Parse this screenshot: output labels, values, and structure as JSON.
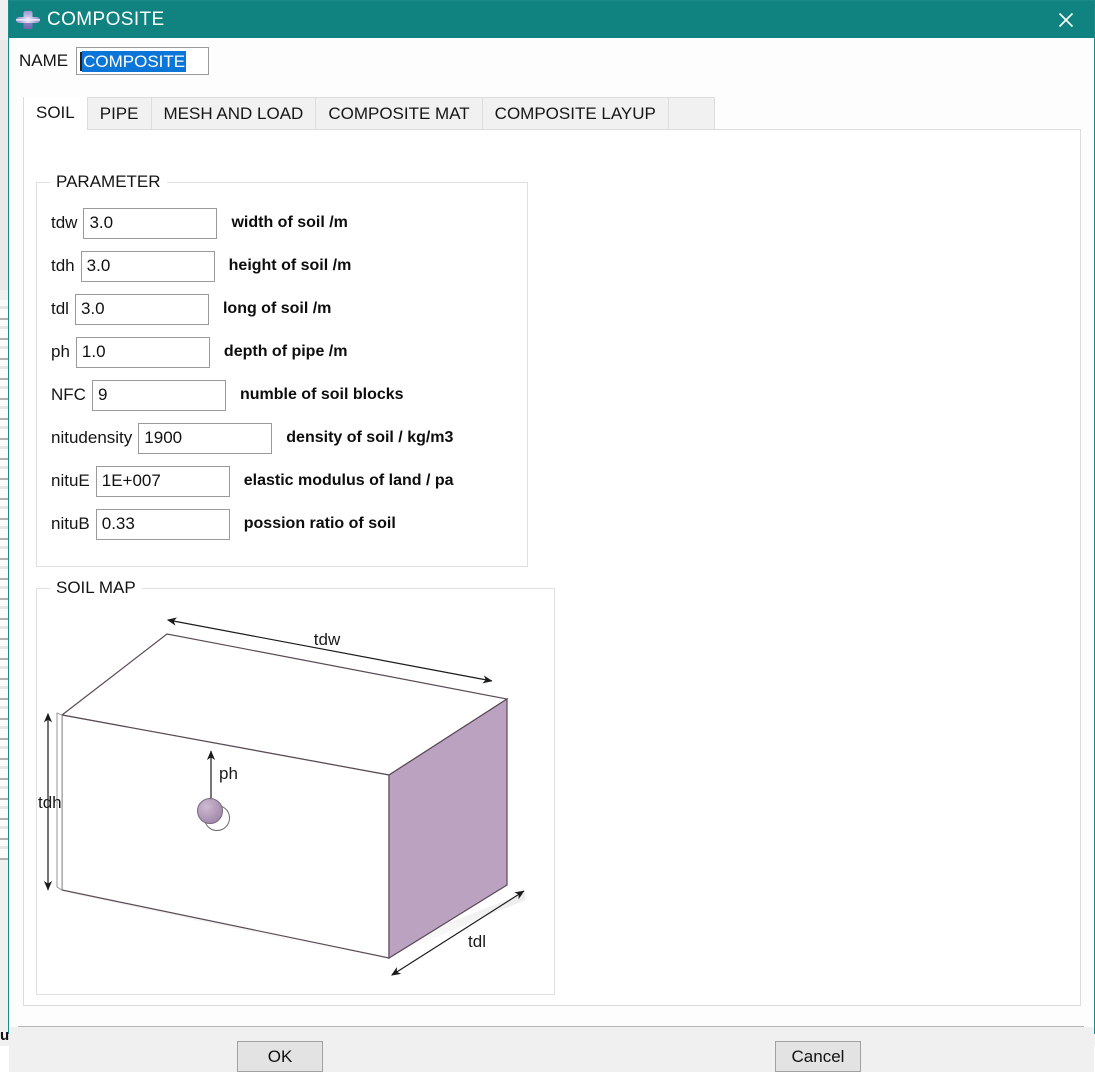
{
  "window": {
    "title": "COMPOSITE",
    "icon": "composite-cross-icon",
    "close_label": "✕",
    "titlebar_color": "#10827f"
  },
  "name_field": {
    "label": "NAME",
    "value": "COMPOSITE",
    "selected": true,
    "selection_color": "#0c76d8"
  },
  "tabs": [
    {
      "label": "SOIL",
      "active": true
    },
    {
      "label": "PIPE",
      "active": false
    },
    {
      "label": "MESH AND LOAD",
      "active": false
    },
    {
      "label": "COMPOSITE MAT",
      "active": false
    },
    {
      "label": "COMPOSITE LAYUP",
      "active": false
    }
  ],
  "parameter_group": {
    "title": "PARAMETER",
    "rows": [
      {
        "label": "tdw",
        "value": "3.0",
        "desc": "width of soil /m",
        "input_width": 134
      },
      {
        "label": "tdh",
        "value": "3.0",
        "desc": "height of soil /m",
        "input_width": 134
      },
      {
        "label": "tdl",
        "value": "3.0",
        "desc": "long of soil /m",
        "input_width": 134
      },
      {
        "label": "ph",
        "value": "1.0",
        "desc": "depth of pipe /m",
        "input_width": 134
      },
      {
        "label": "NFC",
        "value": "9",
        "desc": "numble of soil blocks",
        "input_width": 134
      },
      {
        "label": "nitudensity",
        "value": "1900",
        "desc": "density of soil / kg/m3",
        "input_width": 134
      },
      {
        "label": "nituE",
        "value": "1E+007",
        "desc": "elastic modulus of land / pa",
        "input_width": 134
      },
      {
        "label": "nituB",
        "value": "0.33",
        "desc": "possion ratio of soil",
        "input_width": 134
      }
    ]
  },
  "soil_map": {
    "title": "SOIL MAP",
    "dimension_labels": {
      "width": "tdw",
      "height": "tdh",
      "length": "tdl",
      "pipe_depth": "ph"
    },
    "colors": {
      "side_face": "#bba2c1",
      "outline": "#5a4a57",
      "arrow": "#1b1b1b"
    }
  },
  "footer": {
    "ok_label": "OK",
    "cancel_label": "Cancel"
  },
  "background": {
    "cut_off_text": "uggested"
  }
}
